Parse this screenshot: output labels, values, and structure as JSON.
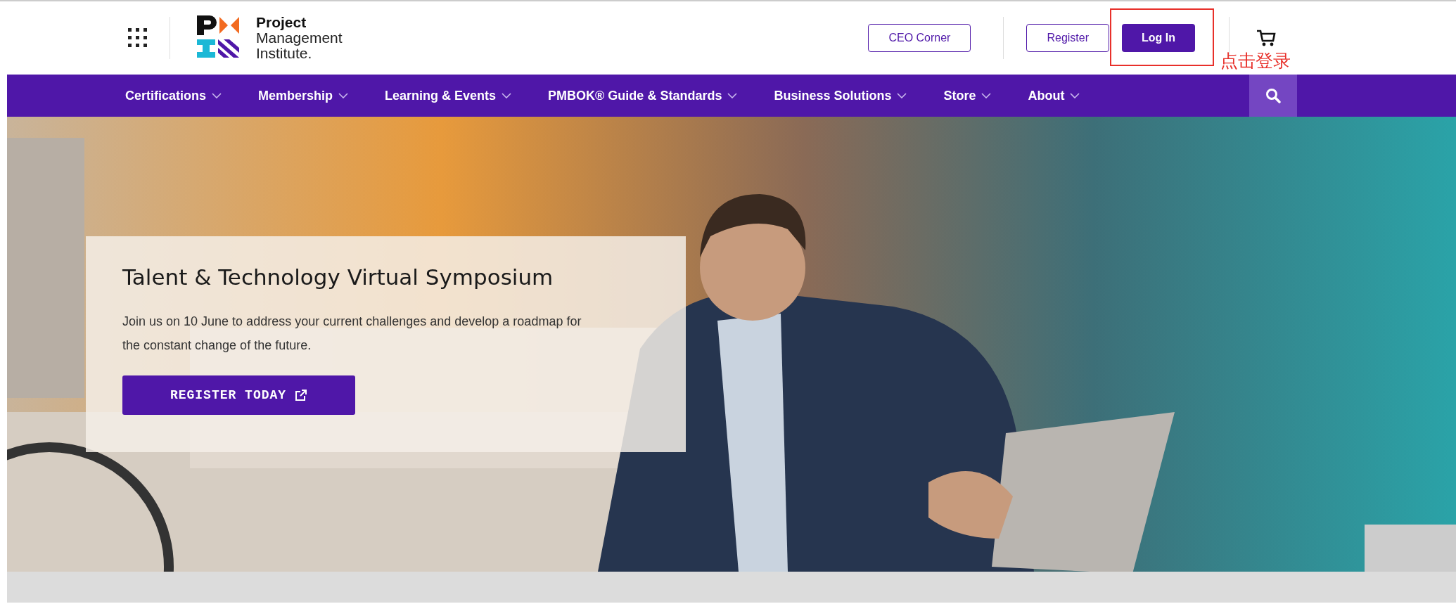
{
  "header": {
    "logo": {
      "line_1": "Project",
      "line_2": "Management",
      "line_3": "Institute."
    },
    "buttons": [
      {
        "label": "CEO Corner",
        "kind": "outline"
      },
      {
        "label": "Register",
        "kind": "outline"
      },
      {
        "label": "Log In",
        "kind": "primary"
      }
    ]
  },
  "annotation": {
    "label": "点击登录"
  },
  "nav": {
    "items": [
      {
        "label": "Certifications"
      },
      {
        "label": "Membership"
      },
      {
        "label": "Learning & Events"
      },
      {
        "label": "PMBOK® Guide & Standards"
      },
      {
        "label": "Business Solutions"
      },
      {
        "label": "Store"
      },
      {
        "label": "About"
      }
    ]
  },
  "hero": {
    "kind": "picture",
    "card": {
      "title": "Talent & Technology Virtual Symposium",
      "text": "Join us on 10 June to address your current challenges and develop a roadmap for the constant change of the future.",
      "button": "REGISTER TODAY"
    }
  }
}
